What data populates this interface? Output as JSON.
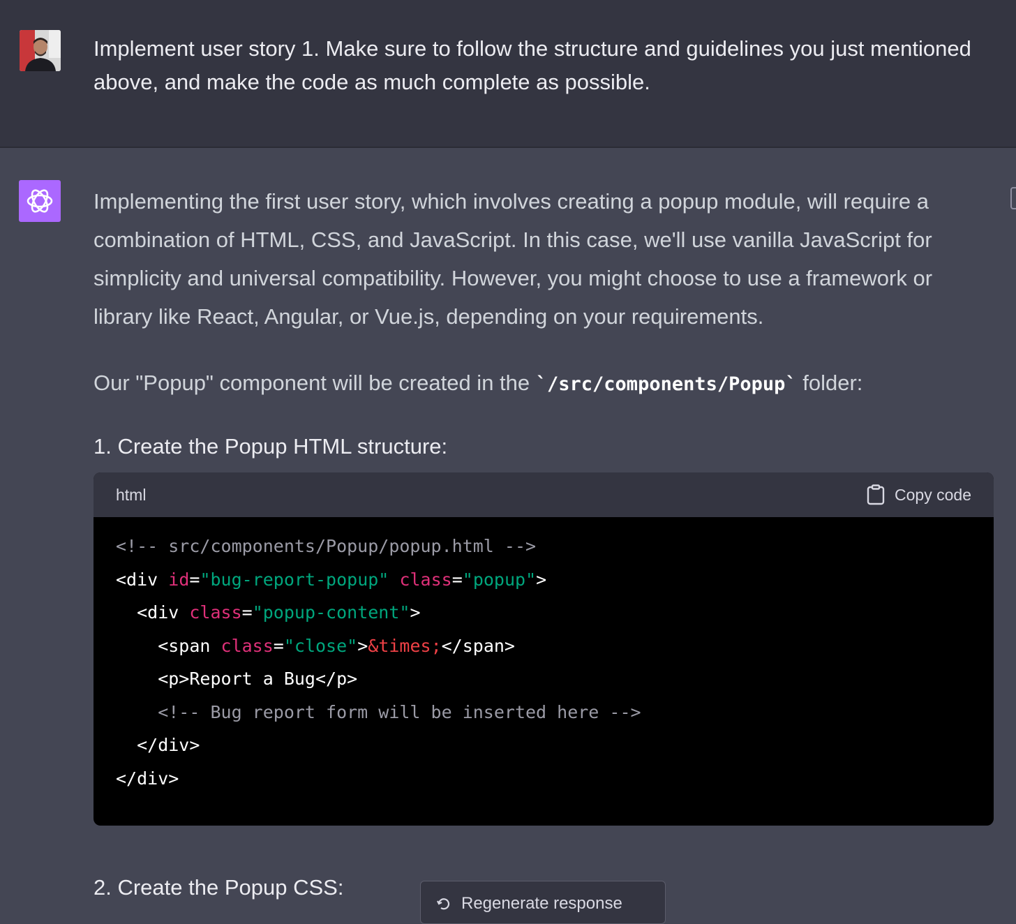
{
  "user_message": {
    "text": "Implement user story 1. Make sure to follow the structure and guidelines you just mentioned above, and make the code as much complete as possible."
  },
  "assistant_message": {
    "intro": "Implementing the first user story, which involves creating a popup module, will require a combination of HTML, CSS, and JavaScript. In this case, we'll use vanilla JavaScript for simplicity and universal compatibility. However, you might choose to use a framework or library like React, Angular, or Vue.js, depending on your requirements.",
    "folder_prefix": "Our \"Popup\" component will be created in the ",
    "folder_code": "`/src/components/Popup`",
    "folder_suffix": " folder:",
    "step1": "1. Create the Popup HTML structure:",
    "step2": "2. Create the Popup CSS:"
  },
  "code_block": {
    "language": "html",
    "copy_label": "Copy code",
    "lines": {
      "l1": "<!-- src/components/Popup/popup.html -->",
      "l2_open": "<div ",
      "l2_attr1": "id",
      "l2_eq1": "=",
      "l2_val1": "\"bug-report-popup\"",
      "l2_sp": " ",
      "l2_attr2": "class",
      "l2_eq2": "=",
      "l2_val2": "\"popup\"",
      "l2_close": ">",
      "l3_open": "  <div ",
      "l3_attr": "class",
      "l3_eq": "=",
      "l3_val": "\"popup-content\"",
      "l3_close": ">",
      "l4_open": "    <span ",
      "l4_attr": "class",
      "l4_eq": "=",
      "l4_val": "\"close\"",
      "l4_gt": ">",
      "l4_ent": "&times;",
      "l4_close": "</span>",
      "l5": "    <p>Report a Bug</p>",
      "l6": "    <!-- Bug report form will be inserted here -->",
      "l7": "  </div>",
      "l8": "</div>"
    }
  },
  "regenerate": {
    "label": "Regenerate response"
  },
  "colors": {
    "page_bg": "#444654",
    "user_bg": "#343541",
    "bot_avatar": "#ab68ff",
    "code_bg": "#000000",
    "attr": "#df3079",
    "string": "#00a67d",
    "entity": "#ef4146",
    "comment": "#9b9ba6"
  },
  "icons": {
    "user_avatar": "user-avatar-photo",
    "bot_avatar": "openai-logo-icon",
    "copy": "clipboard-icon",
    "regenerate": "refresh-icon"
  }
}
